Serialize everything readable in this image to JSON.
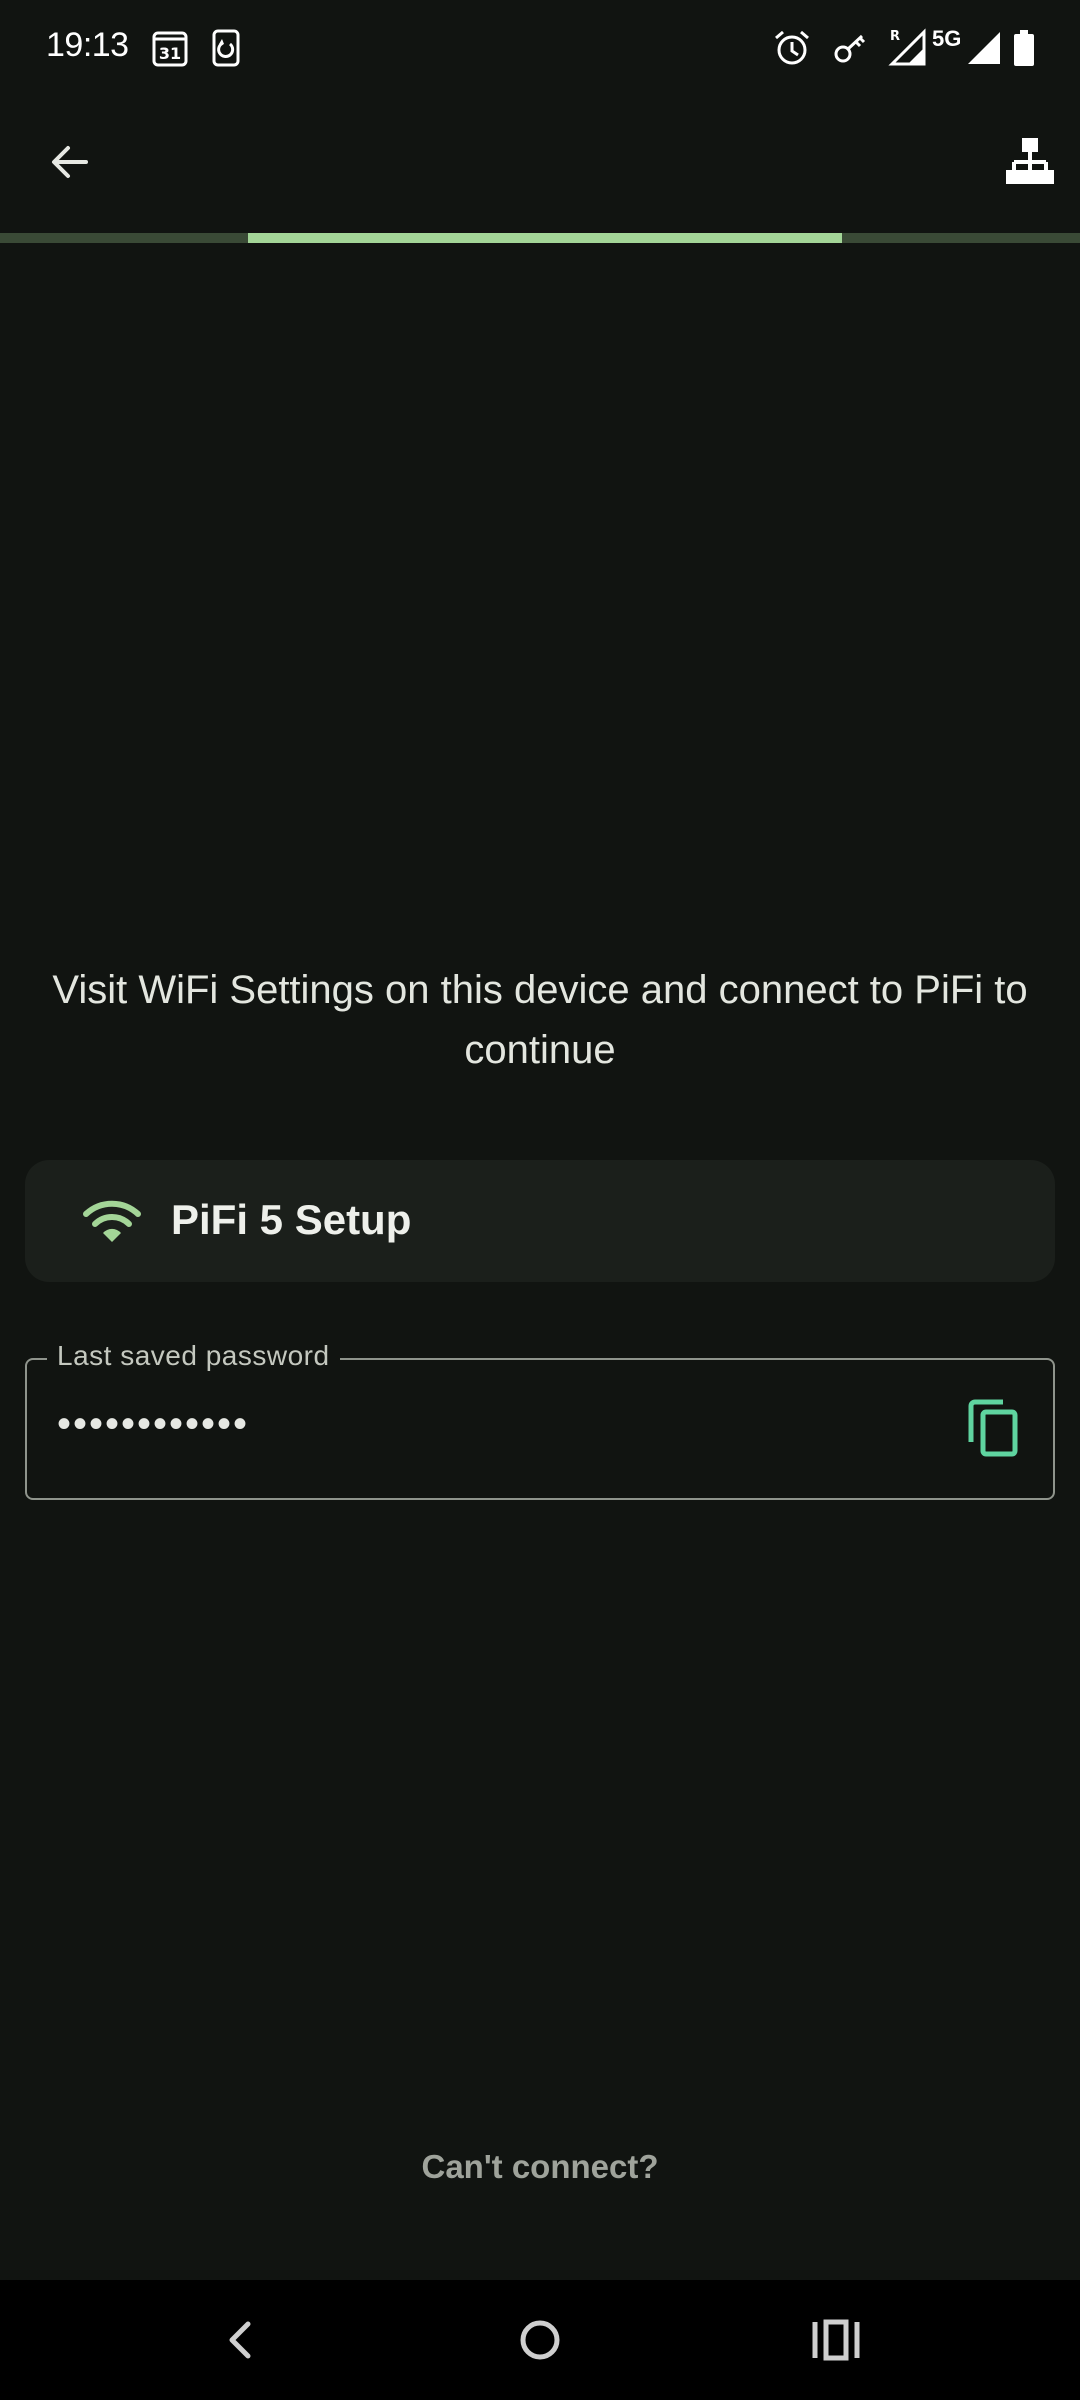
{
  "status_bar": {
    "time": "19:13",
    "calendar_day": "31",
    "network_type": "5G",
    "roaming_indicator": "R",
    "icons": [
      "calendar-icon",
      "phone-sync-icon",
      "alarm-icon",
      "vpn-key-icon",
      "signal-roaming-icon",
      "signal-icon",
      "battery-icon"
    ]
  },
  "toolbar": {
    "back_icon": "arrow-back-icon",
    "action_icon": "network-tree-icon"
  },
  "progress": {
    "segment_start_fraction": 0.23,
    "segment_end_fraction": 0.78,
    "track_color": "#3a4a36",
    "fill_color": "#a3d597"
  },
  "main": {
    "instruction": "Visit WiFi Settings on this device and connect to PiFi to continue",
    "network": {
      "name": "PiFi 5 Setup",
      "icon": "wifi-icon"
    },
    "password_field": {
      "label": "Last saved password",
      "value": "••••••••••••",
      "copy_icon": "copy-icon"
    },
    "cant_connect_label": "Can't connect?"
  },
  "colors": {
    "background": "#111411",
    "accent": "#a3d597",
    "copy_icon": "#5fd4a0",
    "card": "#1b1f1b"
  },
  "nav_bar": {
    "icons": [
      "nav-back-icon",
      "nav-home-icon",
      "nav-recents-icon"
    ]
  }
}
